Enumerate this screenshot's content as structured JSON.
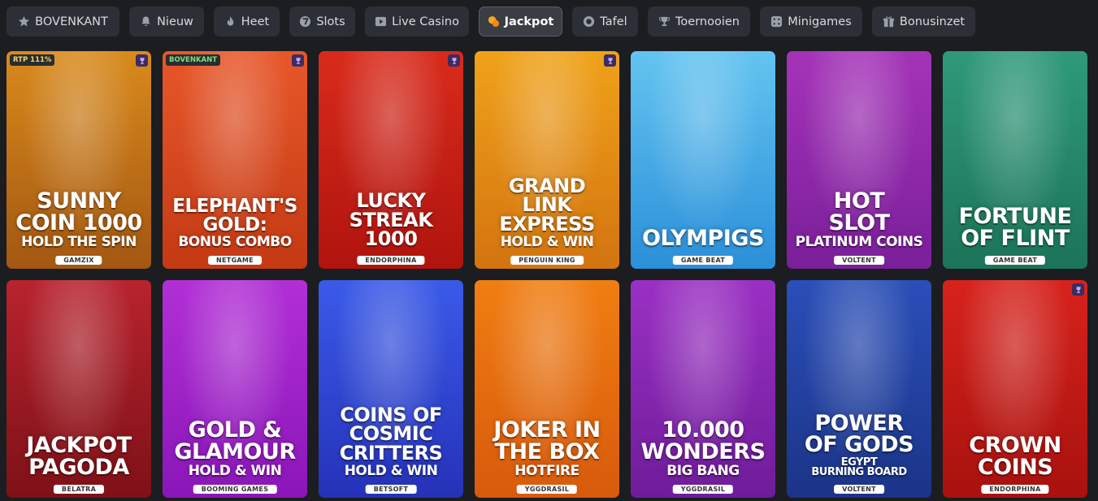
{
  "tabs": [
    {
      "label": "BOVENKANT",
      "icon": "star-icon",
      "active": false
    },
    {
      "label": "Nieuw",
      "icon": "bell-icon",
      "active": false
    },
    {
      "label": "Heet",
      "icon": "flame-icon",
      "active": false
    },
    {
      "label": "Slots",
      "icon": "seven-icon",
      "active": false
    },
    {
      "label": "Live Casino",
      "icon": "play-icon",
      "active": false
    },
    {
      "label": "Jackpot",
      "icon": "coins-icon",
      "active": true
    },
    {
      "label": "Tafel",
      "icon": "chip-icon",
      "active": false
    },
    {
      "label": "Toernooien",
      "icon": "trophy-icon",
      "active": false
    },
    {
      "label": "Minigames",
      "icon": "dice-icon",
      "active": false
    },
    {
      "label": "Bonusinzet",
      "icon": "gift-icon",
      "active": false
    }
  ],
  "games": [
    {
      "line1": "SUNNY\nCOIN 1000",
      "line2": "HOLD THE SPIN",
      "provider": "GAMZIX",
      "badge": "RTP 111%",
      "crown": true,
      "bg": [
        "#d98a1c",
        "#a35712"
      ]
    },
    {
      "line1": "ELEPHANT'S\nGOLD:",
      "line2": "BONUS COMBO",
      "provider": "NETGAME",
      "badge": "BOVENKANT",
      "crown": true,
      "bg": [
        "#e8572a",
        "#c43a14"
      ]
    },
    {
      "line1": "LUCKY\nSTREAK\n1000",
      "line2": "",
      "provider": "ENDORPHINA",
      "badge": "",
      "crown": true,
      "bg": [
        "#d92b1c",
        "#b0140e"
      ]
    },
    {
      "line1": "GRAND\nLINK\nEXPRESS",
      "line2": "HOLD & WIN",
      "provider": "PENGUIN KING",
      "badge": "",
      "crown": true,
      "bg": [
        "#f0a21a",
        "#d37410"
      ]
    },
    {
      "line1": "OLYMPIGS",
      "line2": "",
      "provider": "GAME BEAT",
      "badge": "",
      "crown": false,
      "bg": [
        "#63c4f0",
        "#2b8fd9"
      ]
    },
    {
      "line1": "HOT\nSLOT",
      "line2": "PLATINUM COINS",
      "provider": "VOLTENT",
      "badge": "",
      "crown": false,
      "bg": [
        "#a533b8",
        "#7a1f9a"
      ]
    },
    {
      "line1": "FORTUNE\nOF FLINT",
      "line2": "",
      "provider": "GAME BEAT",
      "badge": "",
      "crown": false,
      "bg": [
        "#2f9a78",
        "#1c7458"
      ]
    },
    {
      "line1": "JACKPOT\nPAGODA",
      "line2": "",
      "provider": "BELATRA",
      "badge": "",
      "crown": false,
      "bg": [
        "#b8232e",
        "#7e1117"
      ]
    },
    {
      "line1": "GOLD &\nGLAMOUR",
      "line2": "HOLD & WIN",
      "provider": "BOOMING GAMES",
      "badge": "",
      "crown": false,
      "bg": [
        "#b22fd6",
        "#8a16b8"
      ]
    },
    {
      "line1": "COINS OF\nCOSMIC\nCRITTERS",
      "line2": "HOLD & WIN",
      "provider": "BETSOFT",
      "badge": "",
      "crown": false,
      "bg": [
        "#3a5ae8",
        "#2532b8"
      ]
    },
    {
      "line1": "JOKER IN\nTHE BOX",
      "line2": "HOTFIRE",
      "provider": "YGGDRASIL",
      "badge": "",
      "crown": false,
      "bg": [
        "#f07e12",
        "#d85a0c"
      ]
    },
    {
      "line1": "10.000\nWONDERS",
      "line2": "BIG BANG",
      "provider": "YGGDRASIL",
      "badge": "",
      "crown": false,
      "bg": [
        "#9b30c4",
        "#6f1c9a"
      ]
    },
    {
      "line1": "POWER\nOF GODS",
      "line2": "EGYPT\nBURNING BOARD",
      "provider": "VOLTENT",
      "badge": "",
      "crown": false,
      "bg": [
        "#2a4fb8",
        "#1b3488"
      ]
    },
    {
      "line1": "CROWN\nCOINS",
      "line2": "",
      "provider": "ENDORPHINA",
      "badge": "",
      "crown": true,
      "bg": [
        "#d8221c",
        "#a8120f"
      ]
    }
  ]
}
